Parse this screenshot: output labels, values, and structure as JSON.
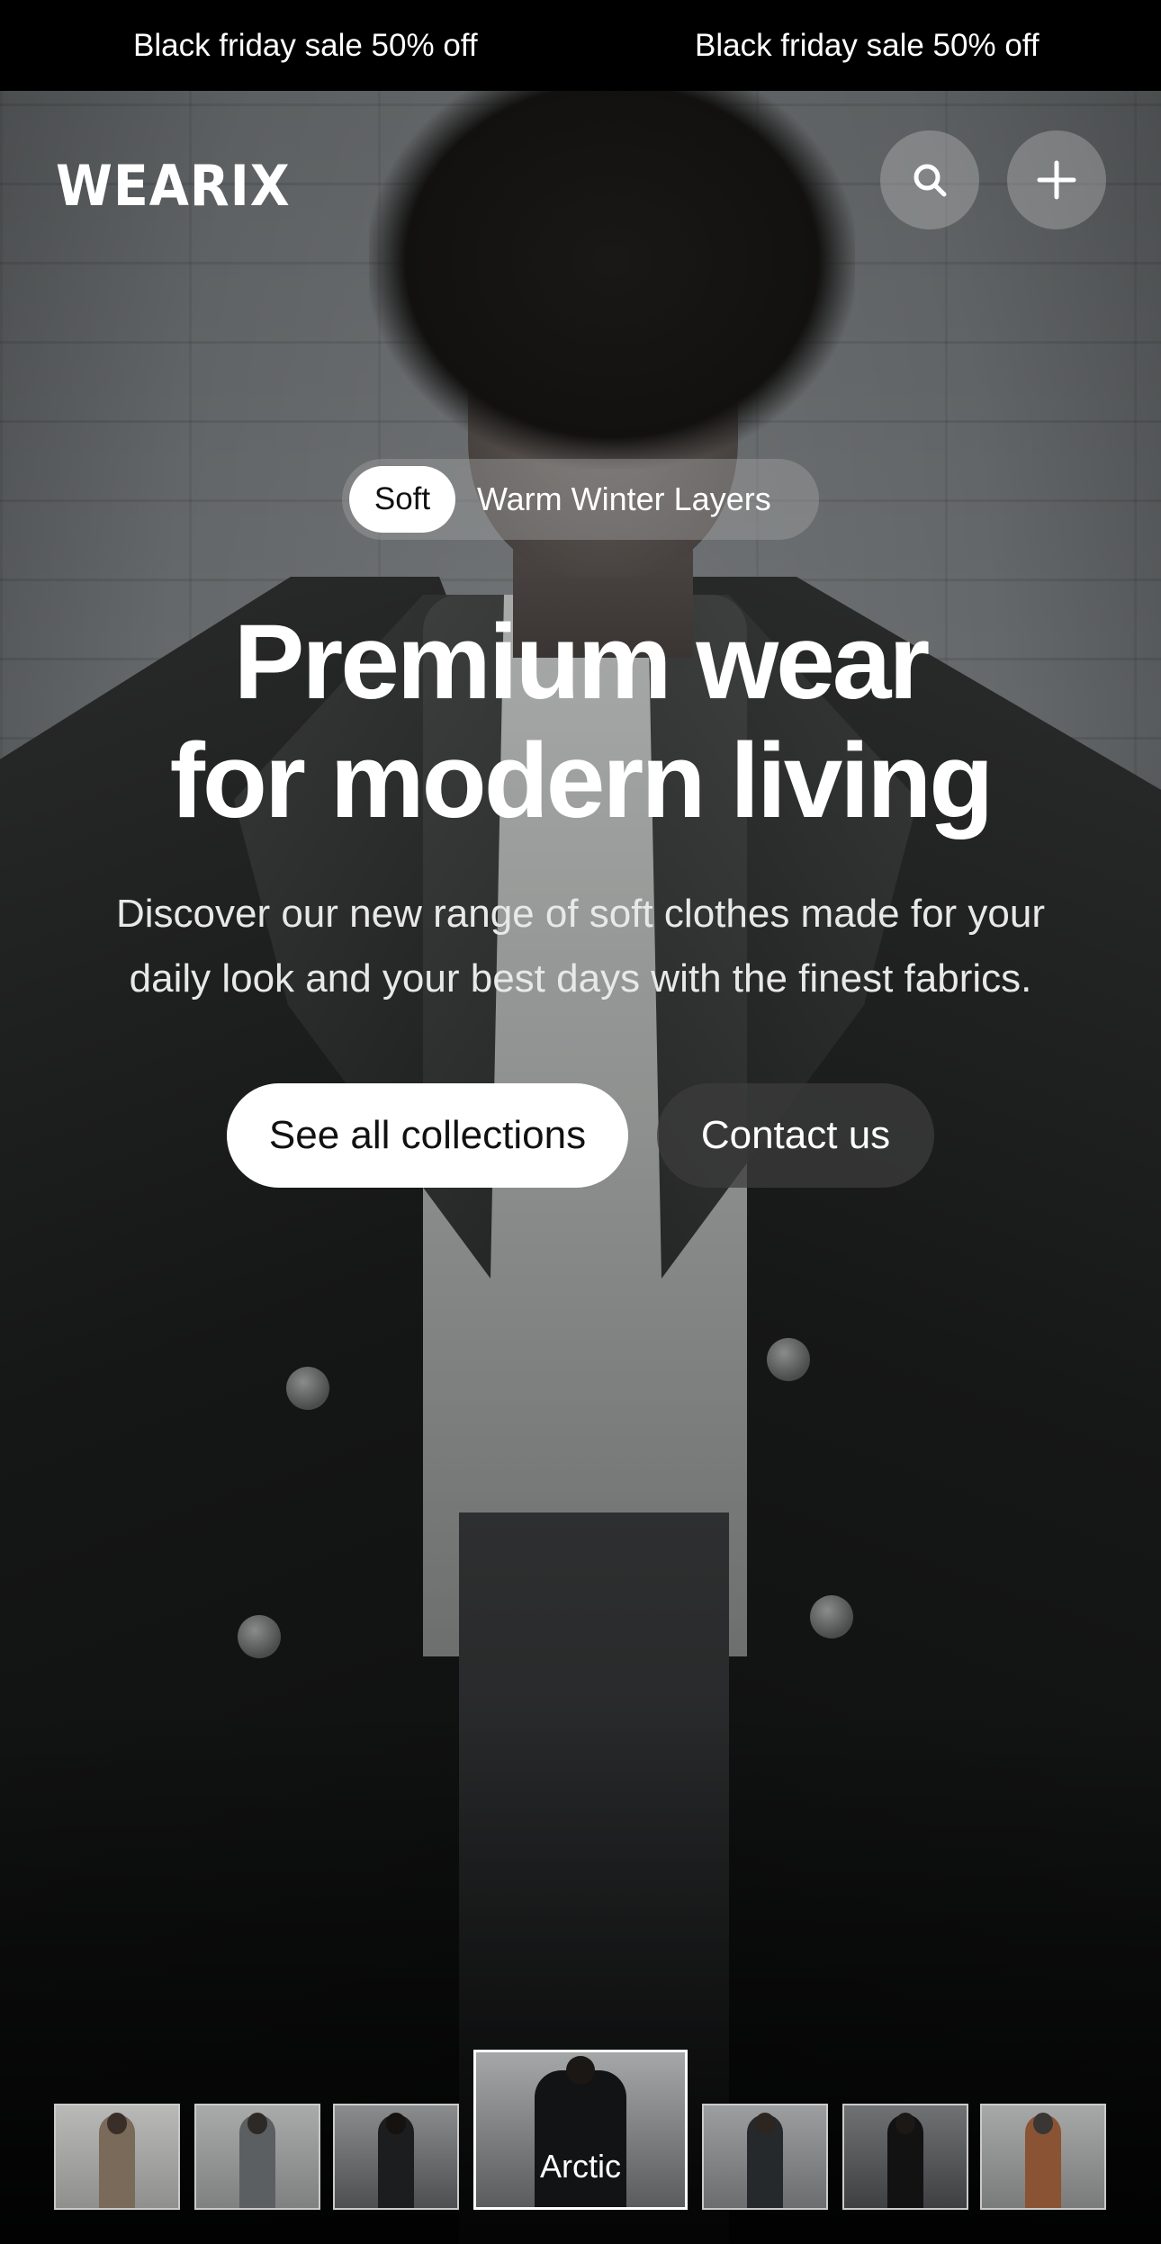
{
  "announcement": {
    "messages": [
      "Black friday sale 50% off",
      "Black friday sale 50% off"
    ]
  },
  "header": {
    "logo": "WEARIX",
    "search_icon": "search-icon",
    "add_icon": "plus-icon"
  },
  "hero": {
    "tag_pill": {
      "badge": "Soft",
      "text": "Warm Winter Layers"
    },
    "headline_line1": "Premium wear",
    "headline_line2": "for modern living",
    "subtext_line1": "Discover our new range of soft clothes made for your",
    "subtext_line2": "daily look and your best days with the finest fabrics.",
    "primary_cta": "See all collections",
    "secondary_cta": "Contact us"
  },
  "collections": {
    "active_label": "Arctic",
    "thumbnails": [
      "thumb-1",
      "thumb-2",
      "thumb-3",
      "thumb-arctic",
      "thumb-5",
      "thumb-6",
      "thumb-7"
    ]
  },
  "colors": {
    "background": "#000000",
    "text": "#ffffff",
    "primary_button": "#ffffff",
    "secondary_button": "#3c3c3c"
  }
}
